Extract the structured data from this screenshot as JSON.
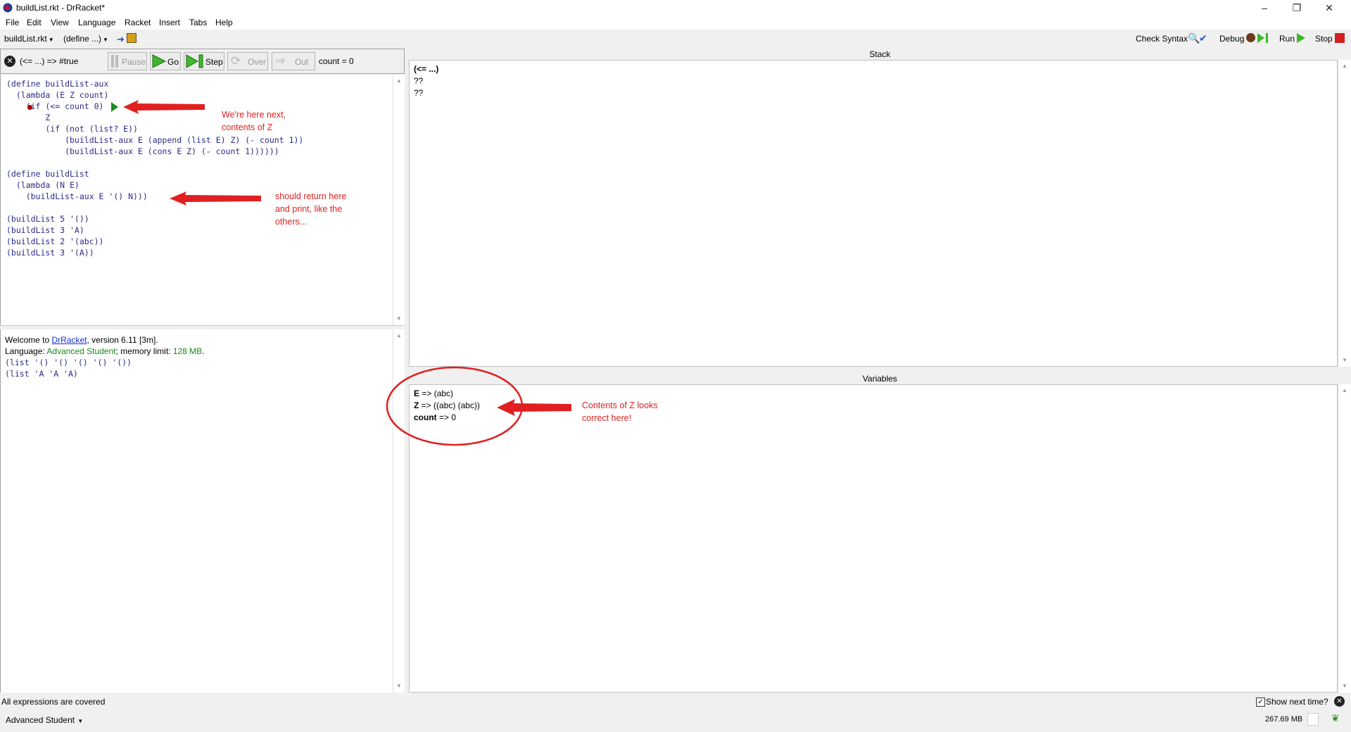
{
  "window": {
    "title": "buildList.rkt - DrRacket*",
    "minimize": "–",
    "restore": "❐",
    "close": "✕"
  },
  "menu": [
    "File",
    "Edit",
    "View",
    "Language",
    "Racket",
    "Insert",
    "Tabs",
    "Help"
  ],
  "toolbar": {
    "file_name": "buildList.rkt",
    "define_menu": "(define ...)",
    "check_syntax": "Check Syntax",
    "debug": "Debug",
    "run": "Run",
    "stop": "Stop"
  },
  "debugger": {
    "current_expr": "(<= ...) => #true",
    "pause": "Pause",
    "go": "Go",
    "step": "Step",
    "over": "Over",
    "out": "Out",
    "count_display": "count = 0"
  },
  "editor": {
    "lines": [
      "(define buildList-aux",
      "  (lambda (E Z count)",
      "    (if (<= count 0)",
      "        Z",
      "        (if (not (list? E))",
      "            (buildList-aux E (append (list E) Z) (- count 1))",
      "            (buildList-aux E (cons E Z) (- count 1))))))",
      "",
      "(define buildList",
      "  (lambda (N E)",
      "    (buildList-aux E '() N)))",
      "",
      "(buildList 5 '())",
      "(buildList 3 'A)",
      "(buildList 2 '(abc))",
      "(buildList 3 '(A))"
    ]
  },
  "interactions": {
    "welcome_prefix": "Welcome to ",
    "welcome_link": "DrRacket",
    "welcome_suffix": ", version 6.11 [3m].",
    "language_prefix": "Language: ",
    "language_name": "Advanced Student",
    "language_mid": "; memory limit: ",
    "memory_limit": "128 MB",
    "language_end": ".",
    "outputs": [
      "(list '() '() '() '() '())",
      "(list 'A 'A 'A)"
    ]
  },
  "stack": {
    "header": "Stack",
    "frames": [
      "(<= ...)",
      "??",
      "??"
    ]
  },
  "variables": {
    "header": "Variables",
    "items": [
      {
        "name": "E",
        "value": " => (abc)"
      },
      {
        "name": "Z",
        "value": " => ((abc) (abc))"
      },
      {
        "name": "count",
        "value": " => 0"
      }
    ]
  },
  "annotations": {
    "here_next": "We're here next,\ncontents of Z",
    "should_return": "should return here\nand print, like the\nothers...",
    "z_correct": "Contents of Z looks\ncorrect here!"
  },
  "status": {
    "coverage": "All expressions are covered",
    "language": "Advanced Student",
    "show_next_time": "Show next time?",
    "memory": "267.69 MB"
  },
  "colors": {
    "accent_red": "#e02020",
    "code_blue": "#2a2a8a",
    "lang_green": "#1a8a1a"
  }
}
